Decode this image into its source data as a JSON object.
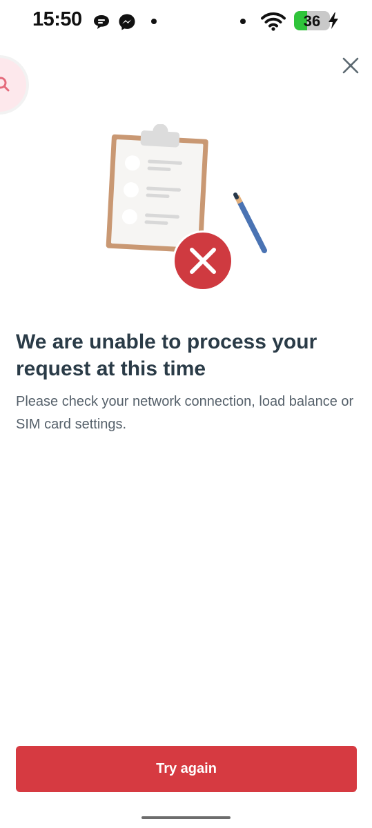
{
  "status_bar": {
    "time": "15:50",
    "battery_level": "36",
    "battery_fraction": 0.36,
    "charging": true,
    "icons": [
      "chat-bubble-icon",
      "messenger-icon",
      "notification-dot",
      "notification-dot",
      "wifi-icon",
      "battery-icon",
      "charging-bolt-icon"
    ]
  },
  "floating_bubble": {
    "icon": "search-icon"
  },
  "close": {
    "icon": "close-icon"
  },
  "illustration": {
    "name": "clipboard-error-illustration",
    "error_icon": "x-icon"
  },
  "error": {
    "title": "We are unable to process your request at this time",
    "message": "Please check your network connection, load balance or SIM card settings."
  },
  "actions": {
    "try_again_label": "Try again"
  },
  "colors": {
    "accent": "#d63a41",
    "title": "#2a3b47",
    "body": "#55606a",
    "battery_fill": "#2fc43a"
  }
}
